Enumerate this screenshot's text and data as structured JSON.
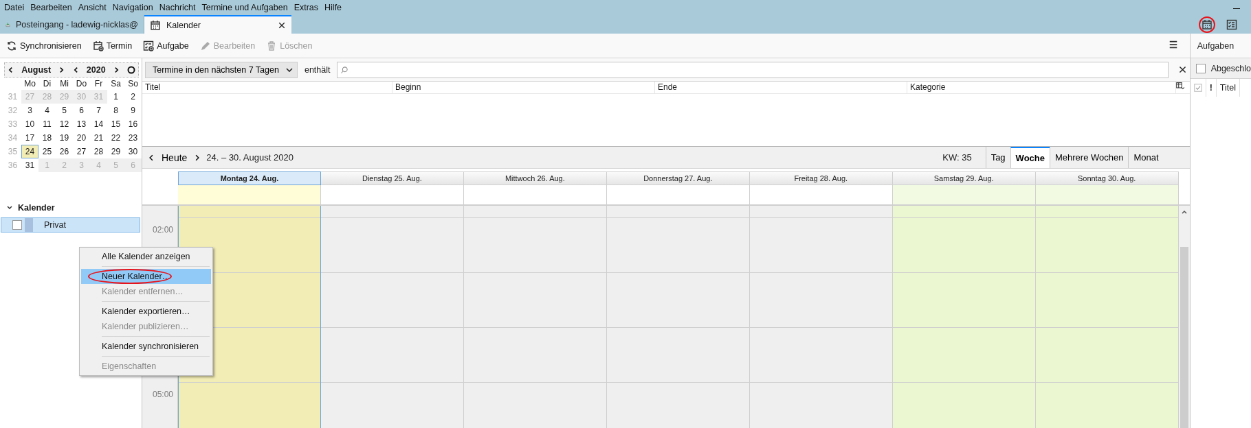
{
  "menu_bar": [
    {
      "label": "Datei"
    },
    {
      "label": "Bearbeiten"
    },
    {
      "label": "Ansicht"
    },
    {
      "label": "Navigation"
    },
    {
      "label": "Nachricht"
    },
    {
      "label": "Termine und Aufgaben"
    },
    {
      "label": "Extras"
    },
    {
      "label": "Hilfe"
    }
  ],
  "tabs": [
    {
      "label": "Posteingang - ladewig-nicklas@",
      "kind": "mail",
      "selected": false,
      "closable": false
    },
    {
      "label": "Kalender",
      "kind": "calendar",
      "selected": true,
      "closable": true
    }
  ],
  "mode_buttons": [
    {
      "kind": "calendar",
      "circled": true
    },
    {
      "kind": "tasks",
      "circled": false
    }
  ],
  "toolbar": [
    {
      "label": "Synchronisieren",
      "kind": "sync",
      "disabled": false
    },
    {
      "label": "Termin",
      "kind": "event",
      "disabled": false
    },
    {
      "label": "Aufgabe",
      "kind": "task",
      "disabled": false
    },
    {
      "label": "Bearbeiten",
      "kind": "edit",
      "disabled": true
    },
    {
      "label": "Löschen",
      "kind": "delete",
      "disabled": true
    }
  ],
  "mini_calendar": {
    "month": "August",
    "year": "2020",
    "weekdays": [
      "Mo",
      "Di",
      "Mi",
      "Do",
      "Fr",
      "Sa",
      "So"
    ],
    "weeks": [
      {
        "number": "31",
        "days": [
          {
            "label": "27",
            "other_month": true,
            "selected": false
          },
          {
            "label": "28",
            "other_month": true,
            "selected": false
          },
          {
            "label": "29",
            "other_month": true,
            "selected": false
          },
          {
            "label": "30",
            "other_month": true,
            "selected": false
          },
          {
            "label": "31",
            "other_month": true,
            "selected": false
          },
          {
            "label": "1",
            "other_month": false,
            "selected": false
          },
          {
            "label": "2",
            "other_month": false,
            "selected": false
          }
        ]
      },
      {
        "number": "32",
        "days": [
          {
            "label": "3",
            "other_month": false,
            "selected": false
          },
          {
            "label": "4",
            "other_month": false,
            "selected": false
          },
          {
            "label": "5",
            "other_month": false,
            "selected": false
          },
          {
            "label": "6",
            "other_month": false,
            "selected": false
          },
          {
            "label": "7",
            "other_month": false,
            "selected": false
          },
          {
            "label": "8",
            "other_month": false,
            "selected": false
          },
          {
            "label": "9",
            "other_month": false,
            "selected": false
          }
        ]
      },
      {
        "number": "33",
        "days": [
          {
            "label": "10",
            "other_month": false,
            "selected": false
          },
          {
            "label": "11",
            "other_month": false,
            "selected": false
          },
          {
            "label": "12",
            "other_month": false,
            "selected": false
          },
          {
            "label": "13",
            "other_month": false,
            "selected": false
          },
          {
            "label": "14",
            "other_month": false,
            "selected": false
          },
          {
            "label": "15",
            "other_month": false,
            "selected": false
          },
          {
            "label": "16",
            "other_month": false,
            "selected": false
          }
        ]
      },
      {
        "number": "34",
        "days": [
          {
            "label": "17",
            "other_month": false,
            "selected": false
          },
          {
            "label": "18",
            "other_month": false,
            "selected": false
          },
          {
            "label": "19",
            "other_month": false,
            "selected": false
          },
          {
            "label": "20",
            "other_month": false,
            "selected": false
          },
          {
            "label": "21",
            "other_month": false,
            "selected": false
          },
          {
            "label": "22",
            "other_month": false,
            "selected": false
          },
          {
            "label": "23",
            "other_month": false,
            "selected": false
          }
        ]
      },
      {
        "number": "35",
        "days": [
          {
            "label": "24",
            "other_month": false,
            "selected": true
          },
          {
            "label": "25",
            "other_month": false,
            "selected": false
          },
          {
            "label": "26",
            "other_month": false,
            "selected": false
          },
          {
            "label": "27",
            "other_month": false,
            "selected": false
          },
          {
            "label": "28",
            "other_month": false,
            "selected": false
          },
          {
            "label": "29",
            "other_month": false,
            "selected": false
          },
          {
            "label": "30",
            "other_month": false,
            "selected": false
          }
        ]
      },
      {
        "number": "36",
        "days": [
          {
            "label": "31",
            "other_month": false,
            "selected": false
          },
          {
            "label": "1",
            "other_month": true,
            "selected": false
          },
          {
            "label": "2",
            "other_month": true,
            "selected": false
          },
          {
            "label": "3",
            "other_month": true,
            "selected": false
          },
          {
            "label": "4",
            "other_month": true,
            "selected": false
          },
          {
            "label": "5",
            "other_month": true,
            "selected": false
          },
          {
            "label": "6",
            "other_month": true,
            "selected": false
          }
        ]
      }
    ]
  },
  "calendar_list": {
    "heading": "Kalender",
    "expanded": true,
    "items": [
      {
        "name": "Privat",
        "checked": false,
        "selected": true,
        "color": "#a8c0e0"
      }
    ]
  },
  "context_menu": [
    {
      "label": "Alle Kalender anzeigen",
      "kind": "item",
      "disabled": false,
      "selected": false,
      "circled": false
    },
    {
      "kind": "separator"
    },
    {
      "label": "Neuer Kalender…",
      "kind": "item",
      "disabled": false,
      "selected": true,
      "circled": true
    },
    {
      "label": "Kalender entfernen…",
      "kind": "item",
      "disabled": true,
      "selected": false,
      "circled": false
    },
    {
      "kind": "separator"
    },
    {
      "label": "Kalender exportieren…",
      "kind": "item",
      "disabled": false,
      "selected": false,
      "circled": false
    },
    {
      "label": "Kalender publizieren…",
      "kind": "item",
      "disabled": true,
      "selected": false,
      "circled": false
    },
    {
      "kind": "separator"
    },
    {
      "label": "Kalender synchronisieren",
      "kind": "item",
      "disabled": false,
      "selected": false,
      "circled": false
    },
    {
      "kind": "separator"
    },
    {
      "label": "Eigenschaften",
      "kind": "item",
      "disabled": true,
      "selected": false,
      "circled": false
    }
  ],
  "filter": {
    "range": "Termine in den nächsten 7 Tagen",
    "contains_label": "enthält"
  },
  "event_list": {
    "columns": [
      "Titel",
      "Beginn",
      "Ende",
      "Kategorie"
    ]
  },
  "week_nav": {
    "today": "Heute",
    "range": "24. – 30. August 2020",
    "week_number": "KW: 35",
    "views": [
      {
        "label": "Tag",
        "selected": false
      },
      {
        "label": "Woche",
        "selected": true
      },
      {
        "label": "Mehrere Wochen",
        "selected": false
      },
      {
        "label": "Monat",
        "selected": false
      }
    ]
  },
  "days": [
    {
      "label": "Montag 24. Aug.",
      "today": true,
      "weekend": false
    },
    {
      "label": "Dienstag 25. Aug.",
      "today": false,
      "weekend": false
    },
    {
      "label": "Mittwoch 26. Aug.",
      "today": false,
      "weekend": false
    },
    {
      "label": "Donnerstag 27. Aug.",
      "today": false,
      "weekend": false
    },
    {
      "label": "Freitag 28. Aug.",
      "today": false,
      "weekend": false
    },
    {
      "label": "Samstag 29. Aug.",
      "today": false,
      "weekend": true
    },
    {
      "label": "Sonntag 30. Aug.",
      "today": false,
      "weekend": true
    }
  ],
  "hours": [
    {
      "kind": "labeled",
      "label": "02:00"
    },
    {
      "kind": "blank"
    },
    {
      "kind": "blank"
    },
    {
      "kind": "labeled",
      "label": "05:00"
    }
  ],
  "tasks_pane": {
    "title": "Aufgaben",
    "completed_filter": {
      "label": "Abgeschlo",
      "checked": false
    },
    "columns": [
      {
        "kind": "done"
      },
      {
        "kind": "priority",
        "label": "!"
      },
      {
        "kind": "title",
        "label": "Titel"
      }
    ]
  }
}
